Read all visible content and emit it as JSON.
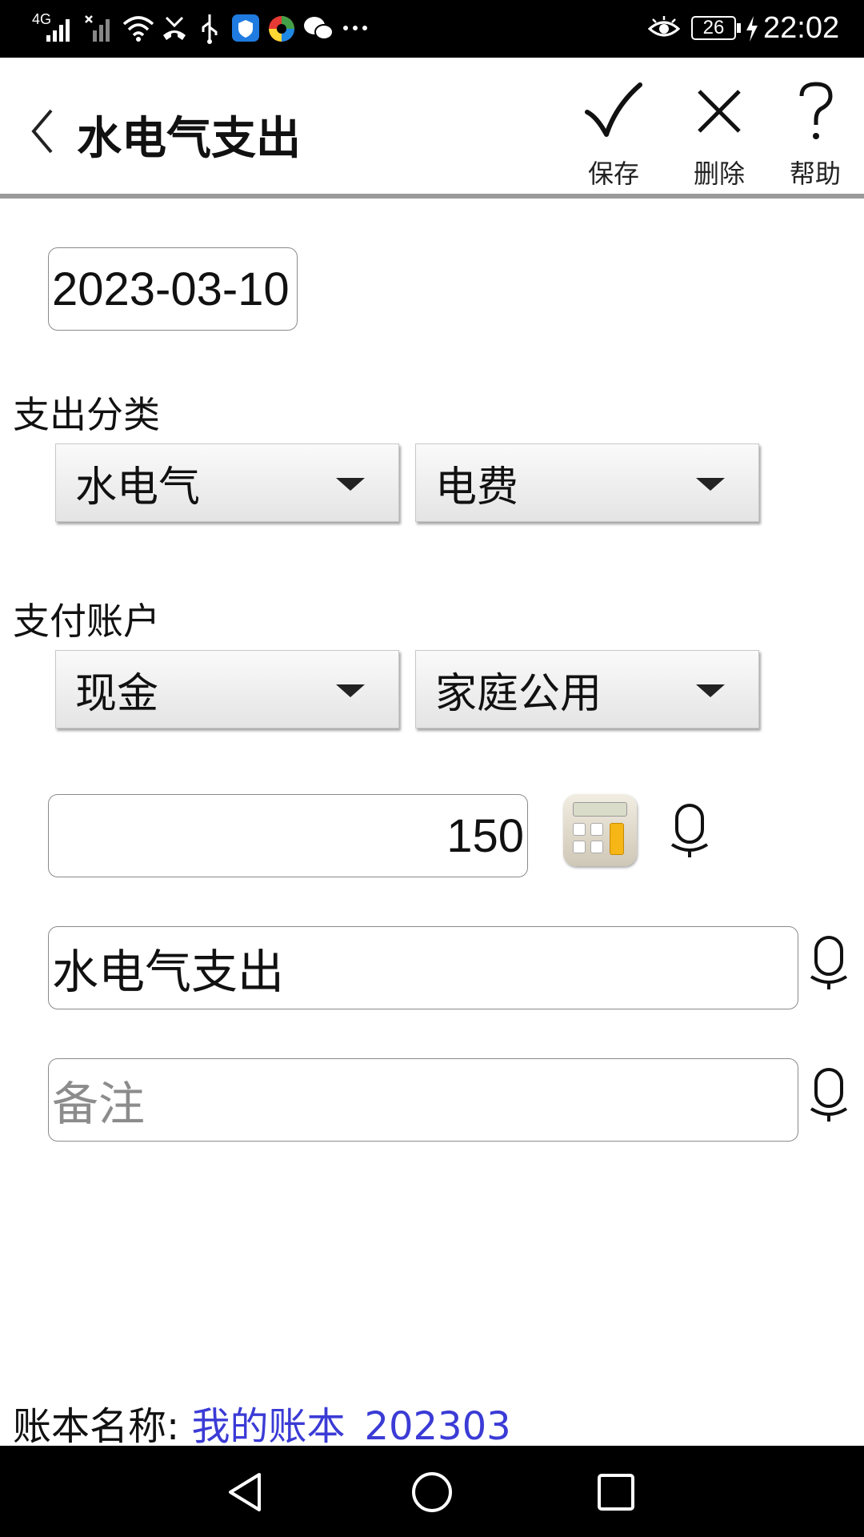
{
  "status_bar": {
    "network": "4G",
    "battery": "26",
    "time": "22:02",
    "icons": [
      "signal-icon",
      "signal-x-icon",
      "wifi-icon",
      "missed-call-icon",
      "usb-icon",
      "shield-app-icon",
      "colorful-app-icon",
      "wechat-icon",
      "more-dots-icon",
      "eye-icon",
      "battery-icon",
      "charging-icon"
    ]
  },
  "app_bar": {
    "title": "水电气支出",
    "save_label": "保存",
    "delete_label": "删除",
    "help_label": "帮助"
  },
  "form": {
    "date": "2023-03-10",
    "category_label": "支出分类",
    "category_main": "水电气",
    "category_sub": "电费",
    "account_label": "支付账户",
    "account_main": "现金",
    "account_sub": "家庭公用",
    "amount": "150",
    "description": "水电气支出",
    "note_placeholder": "备注"
  },
  "footer": {
    "book_label": "账本名称: ",
    "book_name": "我的账本_202303"
  },
  "colors": {
    "link": "#3b3bd6",
    "status_bar": "#000000",
    "divider": "#9a9a9a"
  }
}
